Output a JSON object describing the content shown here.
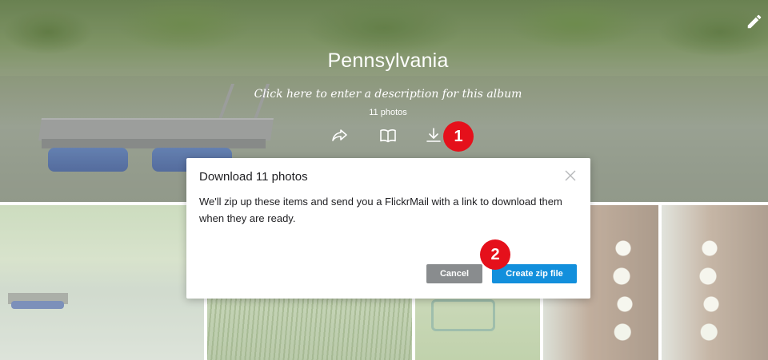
{
  "album": {
    "title": "Pennsylvania",
    "description_placeholder": "Click here to enter a description for this album",
    "photo_count": "11 photos"
  },
  "cover_actions": [
    {
      "icon": "share-icon",
      "label": "Share"
    },
    {
      "icon": "book-icon",
      "label": "Slideshow"
    },
    {
      "icon": "download-icon",
      "label": "Download"
    }
  ],
  "annotations": {
    "step1": "1",
    "step2": "2",
    "badge_color": "#e5101b"
  },
  "dialog": {
    "title": "Download 11 photos",
    "message": "We'll zip up these items and send you a FlickrMail with a link to download them when they are ready.",
    "cancel_label": "Cancel",
    "confirm_label": "Create zip file",
    "confirm_color": "#128fdc",
    "cancel_color": "#898c8e"
  },
  "grid": {
    "tiles": [
      "pond-dock",
      "tall-grass",
      "garden-chair",
      "hollyhocks-barn",
      "hollyhocks-barn-2"
    ]
  }
}
